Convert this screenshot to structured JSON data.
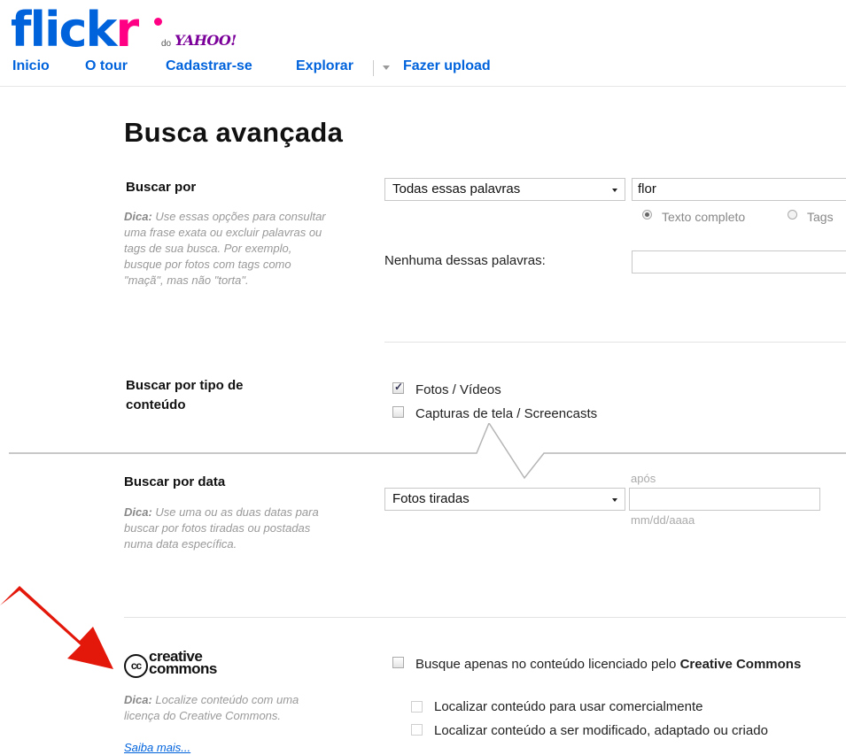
{
  "header": {
    "logo_fli": "flick",
    "logo_r": "r",
    "logo_do": "do",
    "logo_yahoo": "YAHOO!",
    "nav": [
      "Inicio",
      "O tour",
      "Cadastrar-se",
      "Explorar",
      "Fazer upload"
    ]
  },
  "page_title": "Busca avançada",
  "search_by": {
    "title": "Buscar por",
    "tip_bold": "Dica:",
    "tip_text": " Use essas opções para consultar uma frase exata ou excluir palavras ou tags de sua busca. Por exemplo, busque por fotos com tags como \"maçã\", mas não \"torta\".",
    "mode_select": "Todas essas palavras",
    "query_value": "flor",
    "radio_full_text": "Texto completo",
    "radio_tags": "Tags",
    "exclude_label": "Nenhuma dessas palavras:",
    "exclude_value": ""
  },
  "content_type": {
    "title_line1": "Buscar por tipo de",
    "title_line2": "conteúdo",
    "opt_photos": "Fotos / Vídeos",
    "opt_screens": "Capturas de tela / Screencasts",
    "photos_checked": true,
    "screens_checked": false
  },
  "by_date": {
    "title": "Buscar por data",
    "tip_bold": "Dica:",
    "tip_text": " Use uma ou as duas datas para buscar por fotos tiradas ou postadas numa data específica.",
    "date_select": "Fotos tiradas",
    "after_label": "após",
    "date_value": "",
    "date_hint": "mm/dd/aaaa"
  },
  "creative_commons": {
    "logo_cc": "cc",
    "logo_line1": "creative",
    "logo_line2": "commons",
    "tip_bold": "Dica:",
    "tip_text": " Localize conteúdo com uma licença do Creative Commons.",
    "learn_more": "Saiba mais...",
    "main_option_prefix": "Busque apenas no conteúdo licenciado pelo ",
    "main_option_bold": "Creative Commons",
    "opt_commercial": "Localizar conteúdo para usar comercialmente",
    "opt_modify": "Localizar conteúdo a ser modificado, adaptado ou criado"
  },
  "colors": {
    "flickr_blue": "#0063dc",
    "flickr_pink": "#ff0084",
    "yahoo_purple": "#7b0099",
    "annotation_arrow": "#e3170a"
  }
}
